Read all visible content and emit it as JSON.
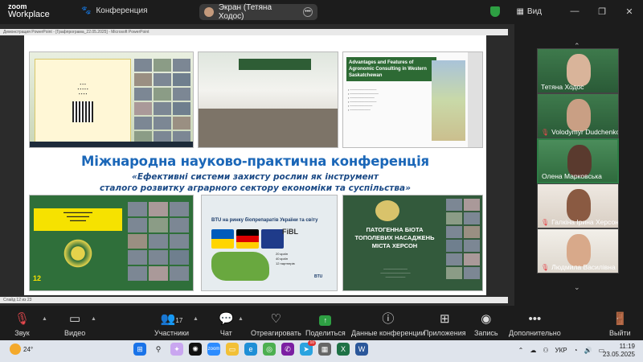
{
  "app": {
    "logo_line1": "zoom",
    "logo_line2": "Workplace",
    "meeting_label": "Конференция",
    "screen_share_label": "Экран (Тетяна Ходос)",
    "view_label": "Вид"
  },
  "slide": {
    "ppt_titlebar": "Демонстрация PowerPoint - [Графпрограма_22.05.2025] - Microsoft PowerPoint",
    "ppt_status": "Слайд 12 из 23",
    "title": "Міжнародна науково-практична конференція",
    "subtitle_line1": "«Ефективні системи захисту рослин як інструмент",
    "subtitle_line2": "сталого розвитку аграрного сектору економіки та суспільства»",
    "thumb3_title": "Advantages and Features of Agronomic Consulting in Western Saskatchewan",
    "thumb5_title": "BTU на ринку біопрепаратів України та світу",
    "thumb5_brand": "FiBL",
    "thumb5_stats": [
      "20 країн",
      "40 країн",
      "12 партнерів"
    ],
    "thumb5_logo": "BTU",
    "thumb6_title": "ПАТОГЕННА БІОТА ТОПОЛЕВИХ НАСАДЖЕНЬ МІСТА ХЕРСОН",
    "thumb4_badge": "12"
  },
  "participants": [
    {
      "name": "Тетяна Ходос",
      "muted": false
    },
    {
      "name": "Volodymyr Dudchenko",
      "muted": true
    },
    {
      "name": "Олена Марковська",
      "muted": false
    },
    {
      "name": "Галкіна Ірина Херсон...",
      "muted": true
    },
    {
      "name": "Людмила Василівна ...",
      "muted": true
    }
  ],
  "controls": {
    "mute": "Звук",
    "video": "Видео",
    "participants": "Участники",
    "participants_count": "17",
    "chat": "Чат",
    "react": "Отреагировать",
    "share": "Поделиться",
    "meeting_data": "Данные конференции",
    "apps": "Приложения",
    "record": "Запись",
    "more": "Дополнительно",
    "leave": "Выйти"
  },
  "taskbar": {
    "temperature": "24°",
    "language": "УКР",
    "time": "11:19",
    "date": "23.05.2025",
    "telegram_badge": "10"
  },
  "colors": {
    "accent_green": "#2ea043",
    "title_blue": "#1b67b8",
    "muted_red": "#e5484d"
  }
}
